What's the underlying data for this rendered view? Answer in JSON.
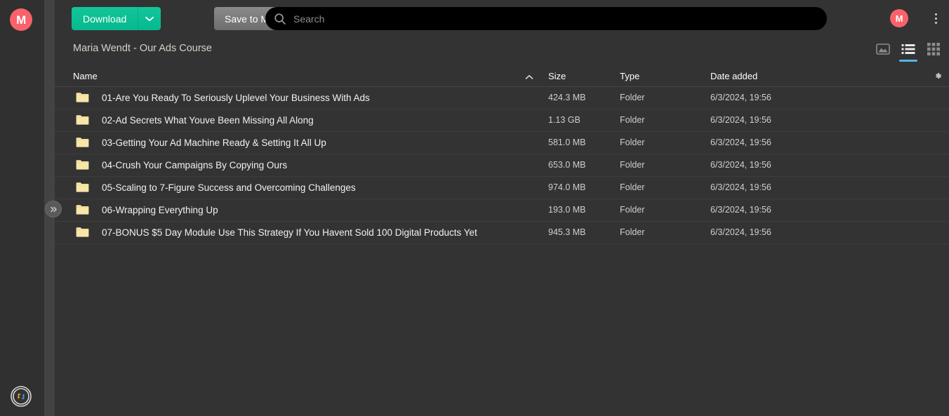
{
  "brand": {
    "logo_letter": "M",
    "logo_color": "#f9626a",
    "accent_green": "#0fbf95",
    "accent_blue": "#4fb8e8",
    "folder_color": "#f7e6a8"
  },
  "toolbar": {
    "download_label": "Download",
    "download_caret_icon": "chevron-down-icon",
    "save_to_mega_label": "Save to MEGA"
  },
  "search": {
    "placeholder": "Search",
    "value": "",
    "icon": "search-icon"
  },
  "account": {
    "avatar_letter": "M",
    "menu_icon": "kebab-menu-icon"
  },
  "rail": {
    "expand_icon": "double-chevron-right-icon",
    "transfer_icon": "transfer-status-icon"
  },
  "breadcrumb": {
    "path": "Maria Wendt - Our Ads Course"
  },
  "view_toggles": [
    {
      "name": "media-view-icon",
      "label": "Media view",
      "active": false
    },
    {
      "name": "list-view-icon",
      "label": "List view",
      "active": true
    },
    {
      "name": "grid-view-icon",
      "label": "Grid view",
      "active": false
    }
  ],
  "table": {
    "columns": {
      "name": "Name",
      "size": "Size",
      "type": "Type",
      "date_added": "Date added"
    },
    "sort": {
      "column": "Name",
      "direction": "asc",
      "icon": "chevron-up-icon"
    },
    "settings_icon": "gear-icon",
    "rows": [
      {
        "icon": "folder-icon",
        "name": "01-Are You Ready To Seriously Uplevel Your Business With Ads",
        "size": "424.3 MB",
        "type": "Folder",
        "date": "6/3/2024, 19:56"
      },
      {
        "icon": "folder-icon",
        "name": "02-Ad Secrets What Youve Been Missing All Along",
        "size": "1.13 GB",
        "type": "Folder",
        "date": "6/3/2024, 19:56"
      },
      {
        "icon": "folder-icon",
        "name": "03-Getting Your Ad Machine Ready & Setting It All Up",
        "size": "581.0 MB",
        "type": "Folder",
        "date": "6/3/2024, 19:56"
      },
      {
        "icon": "folder-icon",
        "name": "04-Crush Your Campaigns By Copying Ours",
        "size": "653.0 MB",
        "type": "Folder",
        "date": "6/3/2024, 19:56"
      },
      {
        "icon": "folder-icon",
        "name": "05-Scaling to 7-Figure Success and Overcoming Challenges",
        "size": "974.0 MB",
        "type": "Folder",
        "date": "6/3/2024, 19:56"
      },
      {
        "icon": "folder-icon",
        "name": "06-Wrapping Everything Up",
        "size": "193.0 MB",
        "type": "Folder",
        "date": "6/3/2024, 19:56"
      },
      {
        "icon": "folder-icon",
        "name": "07-BONUS $5 Day Module Use This Strategy If You Havent Sold 100 Digital Products Yet",
        "size": "945.3 MB",
        "type": "Folder",
        "date": "6/3/2024, 19:56"
      }
    ]
  }
}
